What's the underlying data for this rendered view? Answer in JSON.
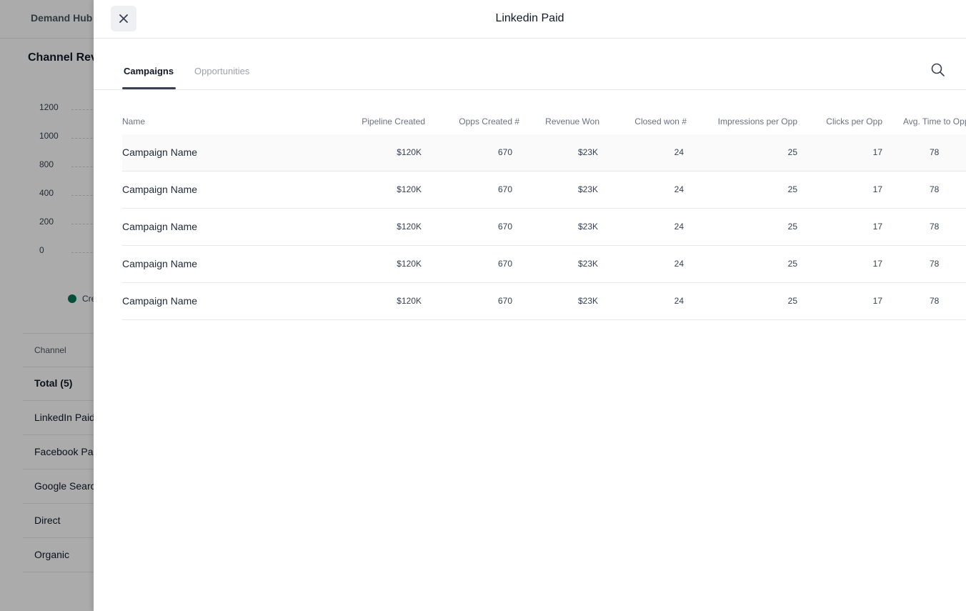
{
  "background": {
    "brand": "Demand Hub",
    "title": "Channel Revenue",
    "chart": {
      "y_ticks": [
        "1200",
        "1000",
        "800",
        "400",
        "200",
        "0"
      ],
      "legend_label": "Created"
    },
    "table": {
      "column_header": "Channel",
      "rows": [
        "Total (5)",
        "LinkedIn Paid",
        "Facebook Paid",
        "Google Search",
        "Direct",
        "Organic"
      ]
    }
  },
  "drawer": {
    "title": "Linkedin Paid",
    "tabs": [
      {
        "label": "Campaigns",
        "active": true
      },
      {
        "label": "Opportunities",
        "active": false
      }
    ],
    "table": {
      "columns": [
        "Name",
        "Pipeline Created",
        "Opps Created #",
        "Revenue Won",
        "Closed won #",
        "Impressions per Opp",
        "Clicks per Opp",
        "Avg. Time to Opp"
      ],
      "rows": [
        [
          "Campaign Name",
          "$120K",
          "670",
          "$23K",
          "24",
          "25",
          "17",
          "78"
        ],
        [
          "Campaign Name",
          "$120K",
          "670",
          "$23K",
          "24",
          "25",
          "17",
          "78"
        ],
        [
          "Campaign Name",
          "$120K",
          "670",
          "$23K",
          "24",
          "25",
          "17",
          "78"
        ],
        [
          "Campaign Name",
          "$120K",
          "670",
          "$23K",
          "24",
          "25",
          "17",
          "78"
        ],
        [
          "Campaign Name",
          "$120K",
          "670",
          "$23K",
          "24",
          "25",
          "17",
          "78"
        ]
      ]
    }
  },
  "icons": {
    "close": "close-icon",
    "search": "search-icon"
  },
  "colors": {
    "legend_created": "#047857",
    "tab_active": "#374151",
    "tab_inactive": "#9ca3af"
  }
}
